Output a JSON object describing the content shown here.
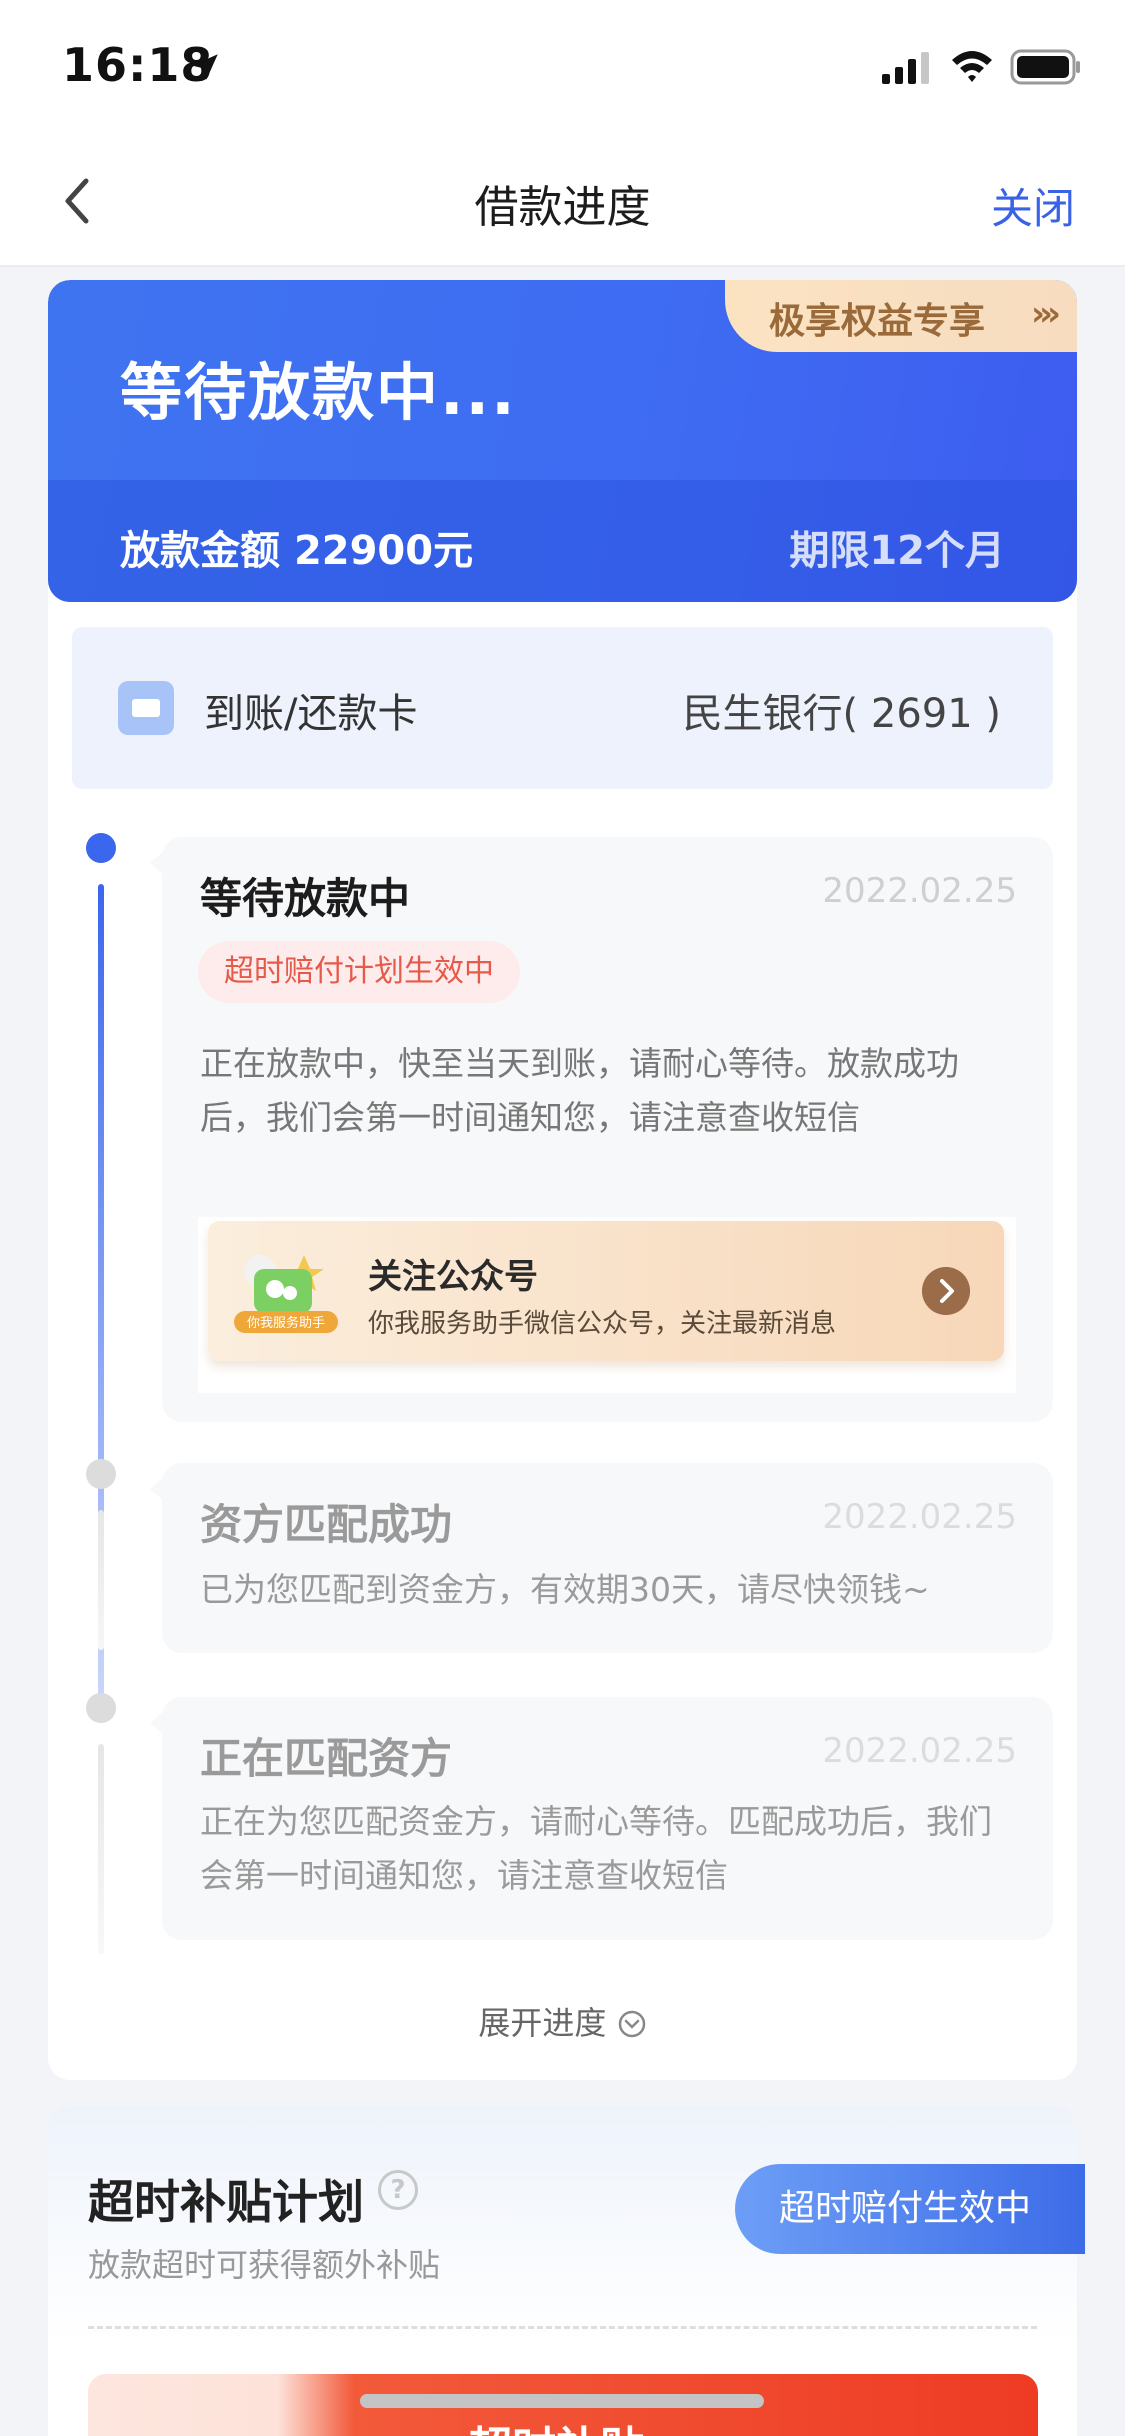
{
  "status_bar": {
    "time": "16:18"
  },
  "nav": {
    "title": "借款进度",
    "close_label": "关闭"
  },
  "hero": {
    "title": "等待放款中...",
    "amount_label": "放款金额",
    "amount_value": "22900元",
    "term": "期限12个月",
    "tag_text": "极享权益专享",
    "tag_arrows": "›››"
  },
  "card_row": {
    "label": "到账/还款卡",
    "value": "民生银行( 2691 )"
  },
  "timeline": [
    {
      "title": "等待放款中",
      "date": "2022.02.25",
      "badge": "超时赔付计划生效中",
      "desc": "正在放款中，快至当天到账，请耐心等待。放款成功后，我们会第一时间通知您，请注意查收短信"
    },
    {
      "title": "资方匹配成功",
      "date": "2022.02.25",
      "desc": "已为您匹配到资金方，有效期30天，请尽快领钱~"
    },
    {
      "title": "正在匹配资方",
      "date": "2022.02.25",
      "desc": "正在为您匹配资金方，请耐心等待。匹配成功后，我们会第一时间通知您，请注意查收短信"
    }
  ],
  "wechat": {
    "logo_text": "你我服务助手",
    "title": "关注公众号",
    "subtitle": "你我服务助手微信公众号，关注最新消息"
  },
  "expand_label": "展开进度",
  "subsidy": {
    "title": "超时补贴计划",
    "help": "?",
    "desc": "放款超时可获得额外补贴",
    "badge": "超时赔付生效中",
    "banner_text": "超时补贴"
  },
  "colors": {
    "accent": "#3a62e6",
    "hero": "#3e6bf2",
    "timeline_active": "#3b66ee"
  }
}
